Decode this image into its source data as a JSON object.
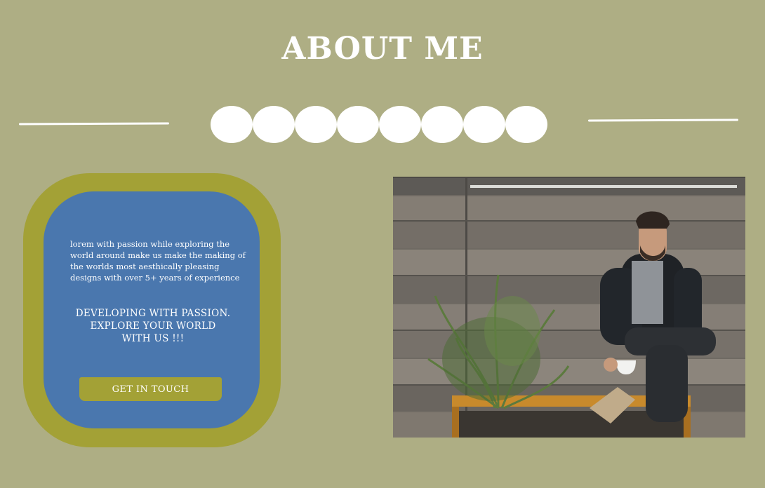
{
  "page": {
    "title": "ABOUT ME",
    "background_color": "#aeae84"
  },
  "divider": {
    "dot_count": 8,
    "color": "#ffffff"
  },
  "card": {
    "outer_color": "#a3a136",
    "inner_color": "#4a77ae",
    "bio": "lorem with passion while exploring the world around make us make the making of the worlds most aesthically pleasing designs with over 5+ years of experience",
    "tagline": [
      "DEVELOPING WITH PASSION.",
      "EXPLORE YOUR WORLD",
      "WITH US !!!"
    ],
    "cta_label": "GET IN TOUCH"
  },
  "photo": {
    "icon": "person-portrait-photo"
  }
}
